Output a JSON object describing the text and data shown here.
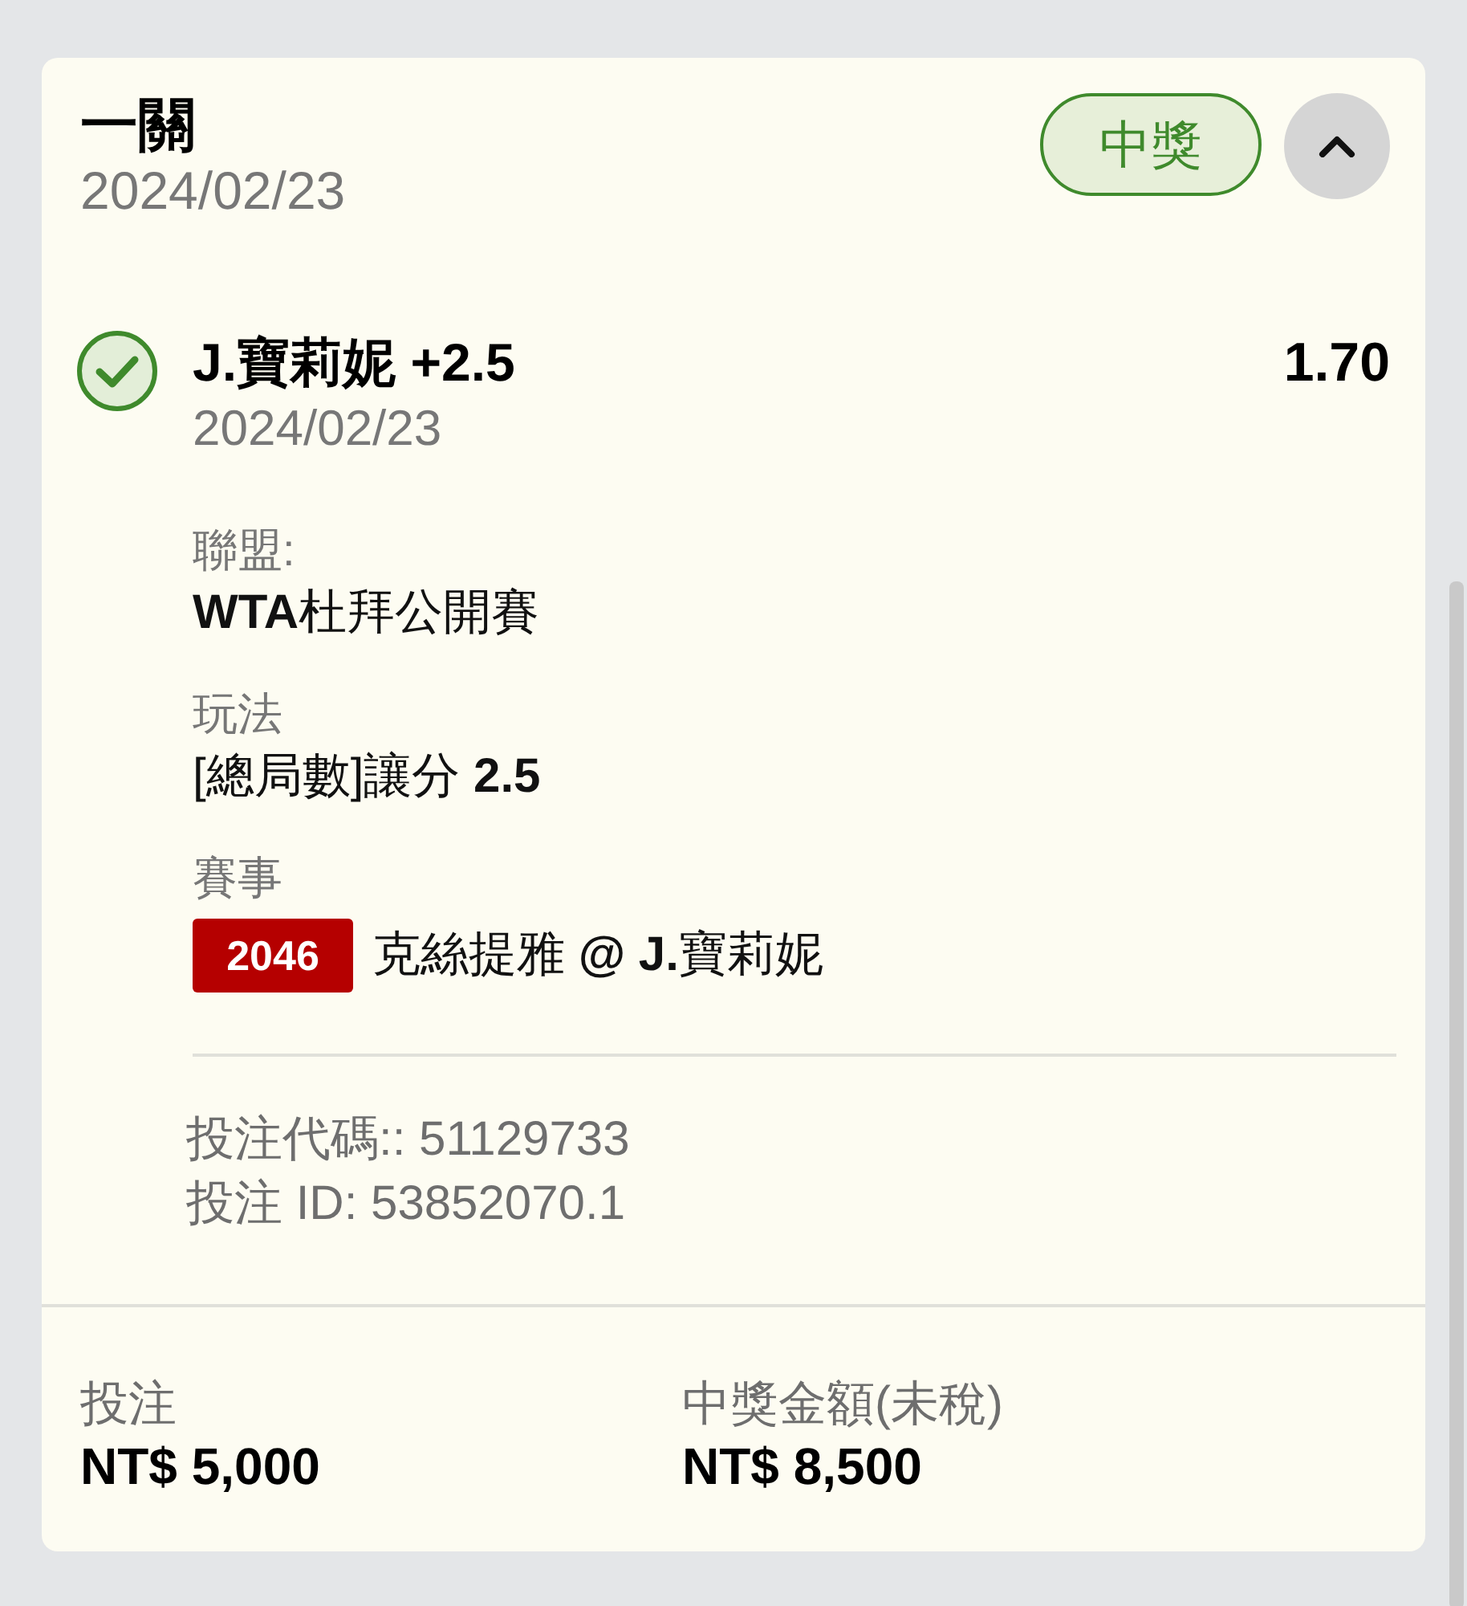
{
  "bet": {
    "title": "一關",
    "date": "2024/02/23",
    "status": {
      "label": "中獎",
      "kind": "won"
    },
    "expanded": true
  },
  "selection": {
    "won": true,
    "name": "J.寶莉妮 +2.5",
    "date": "2024/02/23",
    "odds": "1.70",
    "details": [
      {
        "label": "聯盟:",
        "value": "**WTA**杜拜公開賽"
      },
      {
        "label": "玩法",
        "value": "[總局數]讓分 **2.5**"
      },
      {
        "label": "賽事",
        "event_code": "2046",
        "value": "克絲提雅 **@ J.**寶莉妮"
      }
    ]
  },
  "info": [
    "投注代碼:: 51129733",
    "投注 ID: 53852070.1"
  ],
  "summary": [
    {
      "label": "投注",
      "value": "NT$ 5,000"
    },
    {
      "label": "中獎金額(未稅)",
      "value": "NT$ 8,500"
    }
  ]
}
